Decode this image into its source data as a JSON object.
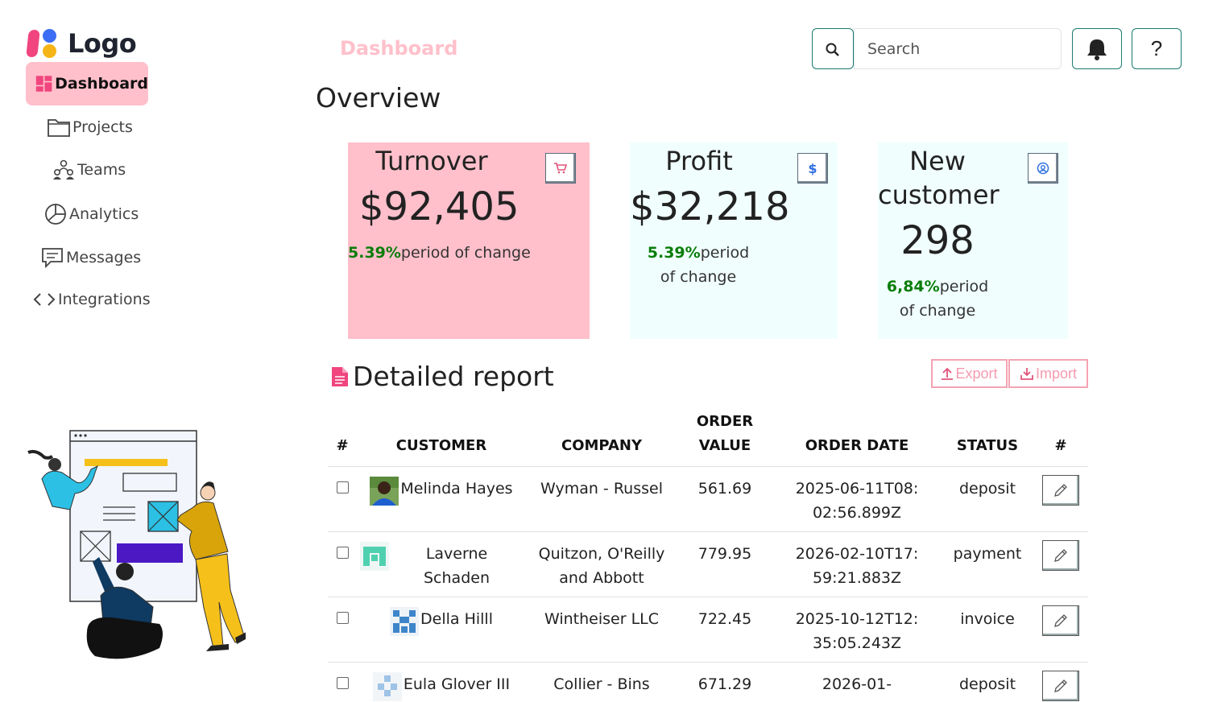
{
  "brand": {
    "logo_text": "Logo"
  },
  "sidebar": {
    "items": [
      {
        "label": "Dashboard",
        "icon": "dashboard-grid-icon",
        "active": true
      },
      {
        "label": "Projects",
        "icon": "folder-icon"
      },
      {
        "label": "Teams",
        "icon": "people-icon"
      },
      {
        "label": "Analytics",
        "icon": "pie-chart-icon"
      },
      {
        "label": "Messages",
        "icon": "chat-icon"
      },
      {
        "label": "Integrations",
        "icon": "code-icon"
      }
    ]
  },
  "header": {
    "breadcrumb": "Dashboard",
    "title": "Overview",
    "search": {
      "placeholder": "Search",
      "value": ""
    },
    "help_label": "?"
  },
  "cards": [
    {
      "title": "Turnover",
      "value": "$92,405",
      "change_pct": "5.39%",
      "change_text": "period of change",
      "icon": "cart-icon",
      "bg": "#ffc0cb"
    },
    {
      "title": "Profit",
      "value": "$32,218",
      "change_pct": "5.39%",
      "change_text": "period of change",
      "icon": "dollar-icon",
      "bg": "#f0fffe"
    },
    {
      "title": "New customer",
      "value": "298",
      "change_pct": "6,84%",
      "change_text": "period of change",
      "icon": "user-circle-icon",
      "bg": "#f0fffe"
    }
  ],
  "report": {
    "title": "Detailed report",
    "export_label": "Export",
    "import_label": "Import",
    "columns": [
      "#",
      "CUSTOMER",
      "COMPANY",
      "ORDER VALUE",
      "ORDER DATE",
      "STATUS",
      "#"
    ],
    "rows": [
      {
        "customer": "Melinda Hayes",
        "company": "Wyman - Russel",
        "order_value": "561.69",
        "order_date": "2025-06-11T08:02:56.899Z",
        "status": "deposit"
      },
      {
        "customer": "Laverne Schaden",
        "company": "Quitzon, O'Reilly and Abbott",
        "order_value": "779.95",
        "order_date": "2026-02-10T17:59:21.883Z",
        "status": "payment"
      },
      {
        "customer": "Della Hilll",
        "company": "Wintheiser LLC",
        "order_value": "722.45",
        "order_date": "2025-10-12T12:35:05.243Z",
        "status": "invoice"
      },
      {
        "customer": "Eula Glover III",
        "company": "Collier - Bins",
        "order_value": "671.29",
        "order_date": "2026-01-",
        "status": "deposit"
      }
    ]
  },
  "colors": {
    "accent": "#ffc0cb",
    "teal": "#1b7a6e",
    "positive": "#0a7d0a",
    "brand_pink": "#f0457e"
  }
}
